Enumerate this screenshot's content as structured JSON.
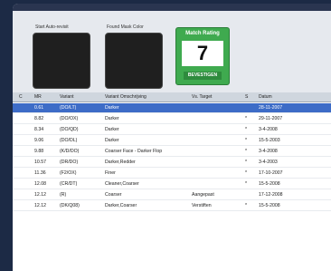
{
  "panel": {
    "left_label": "Start Auto-revisit",
    "right_label": "Found Mask Color"
  },
  "match": {
    "title": "Match Rating",
    "value": "7",
    "button": "BEVESTIGEN"
  },
  "table": {
    "headers": [
      "C",
      "MR",
      "Variant",
      "Variant Omschrijving",
      "Vs. Target",
      "S",
      "Datum"
    ],
    "rows": [
      {
        "c": "",
        "mr": "0.61",
        "variant": "(DO/LT)",
        "omschrijving": "Darker",
        "target": "",
        "s": "",
        "datum": "28-11-2007",
        "selected": true
      },
      {
        "c": "",
        "mr": "8.82",
        "variant": "(DO/OX)",
        "omschrijving": "Darker",
        "target": "",
        "s": "*",
        "datum": "29-11-2007",
        "selected": false
      },
      {
        "c": "",
        "mr": "8.34",
        "variant": "(DO/QD)",
        "omschrijving": "Darker",
        "target": "",
        "s": "*",
        "datum": "3-4-2008",
        "selected": false
      },
      {
        "c": "",
        "mr": "9.06",
        "variant": "(DO/DL)",
        "omschrijving": "Darker",
        "target": "",
        "s": "*",
        "datum": "15-5-2003",
        "selected": false
      },
      {
        "c": "",
        "mr": "9.88",
        "variant": "(K/D/DO)",
        "omschrijving": "Coarser Face - Darker Flop",
        "target": "",
        "s": "*",
        "datum": "3-4-2008",
        "selected": false
      },
      {
        "c": "",
        "mr": "10.57",
        "variant": "(DR/DO)",
        "omschrijving": "Darker,Redder",
        "target": "",
        "s": "*",
        "datum": "3-4-2003",
        "selected": false
      },
      {
        "c": "",
        "mr": "11.36",
        "variant": "(F2/OX)",
        "omschrijving": "Finer",
        "target": "",
        "s": "*",
        "datum": "17-10-2007",
        "selected": false
      },
      {
        "c": "",
        "mr": "12.08",
        "variant": "(CR/DT)",
        "omschrijving": "Cleaner,Coarser",
        "target": "",
        "s": "*",
        "datum": "15-5-2008",
        "selected": false
      },
      {
        "c": "",
        "mr": "12.12",
        "variant": "(R)",
        "omschrijving": "Coarser",
        "target": "Aangepast",
        "s": "",
        "datum": "17-12-2008",
        "selected": false
      },
      {
        "c": "",
        "mr": "12.12",
        "variant": "(DK/Q08)",
        "omschrijving": "Darker,Coarser",
        "target": "Verstiften",
        "s": "*",
        "datum": "15-5-2008",
        "selected": false
      }
    ]
  }
}
